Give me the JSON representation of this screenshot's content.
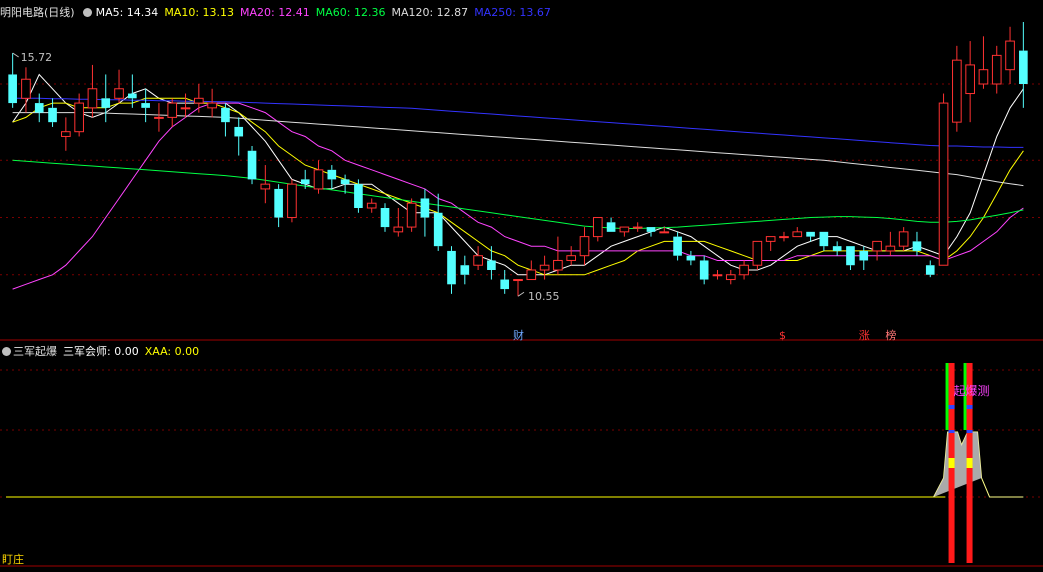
{
  "header": {
    "title": "明阳电路(日线)",
    "indicators": [
      {
        "label": "MA5: 14.34",
        "color": "#ffffff"
      },
      {
        "label": "MA10: 13.13",
        "color": "#ffff00"
      },
      {
        "label": "MA20: 12.41",
        "color": "#ff44ff"
      },
      {
        "label": "MA60: 12.36",
        "color": "#00ff44"
      },
      {
        "label": "MA120: 12.87",
        "color": "#dddddd"
      },
      {
        "label": "MA250: 13.67",
        "color": "#3333ff"
      }
    ]
  },
  "sub_header": {
    "title": "三军起爆",
    "indicators": [
      {
        "label": "三军会师: 0.00",
        "color": "#ffffff"
      },
      {
        "label": "XAA: 0.00",
        "color": "#ffff00"
      }
    ]
  },
  "footer": {
    "button_label": "盯庄"
  },
  "colors": {
    "up": "#ff3232",
    "down": "#54ffff",
    "grid": "#7a0000",
    "border": "#a00000",
    "hi_label": "#c0c0c0"
  },
  "chart_data": [
    {
      "type": "candlestick",
      "price_range": [
        9.8,
        16.3
      ],
      "high_label": "15.72",
      "low_label": "10.55",
      "candles": [
        [
          15.2,
          14.6,
          15.65,
          14.5
        ],
        [
          14.7,
          15.1,
          15.35,
          14.4
        ],
        [
          14.6,
          14.4,
          14.8,
          14.2
        ],
        [
          14.5,
          14.2,
          14.7,
          14.1
        ],
        [
          13.9,
          14.0,
          14.3,
          13.6
        ],
        [
          14.0,
          14.6,
          14.8,
          13.9
        ],
        [
          14.5,
          14.9,
          15.4,
          14.3
        ],
        [
          14.7,
          14.5,
          15.2,
          14.2
        ],
        [
          14.7,
          14.9,
          15.3,
          14.6
        ],
        [
          14.8,
          14.7,
          15.2,
          14.5
        ],
        [
          14.6,
          14.5,
          14.9,
          14.2
        ],
        [
          14.3,
          14.3,
          14.6,
          14.0
        ],
        [
          14.3,
          14.6,
          14.7,
          14.1
        ],
        [
          14.5,
          14.5,
          14.8,
          14.3
        ],
        [
          14.6,
          14.7,
          15.0,
          14.4
        ],
        [
          14.5,
          14.6,
          14.9,
          14.3
        ],
        [
          14.5,
          14.2,
          14.6,
          13.9
        ],
        [
          14.1,
          13.9,
          14.3,
          13.5
        ],
        [
          13.6,
          13.0,
          13.7,
          12.9
        ],
        [
          12.8,
          12.9,
          13.3,
          12.5
        ],
        [
          12.8,
          12.2,
          12.9,
          12.0
        ],
        [
          12.2,
          12.9,
          13.0,
          12.1
        ],
        [
          13.0,
          12.9,
          13.2,
          12.8
        ],
        [
          12.8,
          13.2,
          13.4,
          12.7
        ],
        [
          13.2,
          13.0,
          13.3,
          12.8
        ],
        [
          13.0,
          12.9,
          13.1,
          12.7
        ],
        [
          12.9,
          12.4,
          13.0,
          12.3
        ],
        [
          12.4,
          12.5,
          12.6,
          12.3
        ],
        [
          12.4,
          12.0,
          12.5,
          11.9
        ],
        [
          11.9,
          12.0,
          12.4,
          11.8
        ],
        [
          12.0,
          12.5,
          12.6,
          11.9
        ],
        [
          12.6,
          12.2,
          12.8,
          11.8
        ],
        [
          12.3,
          11.6,
          12.7,
          11.5
        ],
        [
          11.5,
          10.8,
          11.6,
          10.6
        ],
        [
          11.2,
          11.0,
          11.4,
          10.8
        ],
        [
          11.2,
          11.4,
          11.6,
          11.1
        ],
        [
          11.3,
          11.1,
          11.6,
          10.9
        ],
        [
          10.9,
          10.7,
          11.1,
          10.6
        ],
        [
          10.9,
          10.9,
          10.9,
          10.55
        ],
        [
          10.9,
          11.1,
          11.3,
          10.9
        ],
        [
          11.1,
          11.2,
          11.4,
          10.9
        ],
        [
          11.1,
          11.3,
          11.8,
          11.0
        ],
        [
          11.3,
          11.4,
          11.6,
          11.2
        ],
        [
          11.4,
          11.8,
          12.0,
          11.2
        ],
        [
          11.8,
          12.2,
          12.2,
          11.7
        ],
        [
          12.1,
          11.9,
          12.2,
          11.9
        ],
        [
          11.9,
          12.0,
          12.0,
          11.8
        ],
        [
          12.0,
          12.0,
          12.1,
          11.9
        ],
        [
          12.0,
          11.9,
          12.0,
          11.8
        ],
        [
          11.9,
          11.9,
          12.0,
          11.9
        ],
        [
          11.8,
          11.4,
          11.9,
          11.3
        ],
        [
          11.4,
          11.3,
          11.5,
          11.2
        ],
        [
          11.3,
          10.9,
          11.4,
          10.8
        ],
        [
          11.0,
          11.0,
          11.1,
          10.9
        ],
        [
          10.9,
          11.0,
          11.1,
          10.8
        ],
        [
          11.0,
          11.2,
          11.3,
          10.9
        ],
        [
          11.2,
          11.7,
          11.7,
          11.1
        ],
        [
          11.7,
          11.8,
          11.8,
          11.5
        ],
        [
          11.8,
          11.8,
          11.9,
          11.7
        ],
        [
          11.8,
          11.9,
          12.0,
          11.8
        ],
        [
          11.9,
          11.8,
          11.9,
          11.7
        ],
        [
          11.9,
          11.6,
          11.9,
          11.5
        ],
        [
          11.6,
          11.5,
          11.7,
          11.4
        ],
        [
          11.6,
          11.2,
          11.6,
          11.1
        ],
        [
          11.5,
          11.3,
          11.6,
          11.1
        ],
        [
          11.5,
          11.7,
          11.7,
          11.3
        ],
        [
          11.5,
          11.6,
          11.9,
          11.4
        ],
        [
          11.6,
          11.9,
          12.0,
          11.5
        ],
        [
          11.7,
          11.5,
          11.9,
          11.4
        ],
        [
          11.2,
          11.0,
          11.3,
          10.95
        ],
        [
          11.2,
          14.6,
          14.8,
          11.2
        ],
        [
          14.2,
          15.5,
          15.8,
          14.0
        ],
        [
          14.8,
          15.4,
          15.9,
          14.2
        ],
        [
          15.0,
          15.3,
          16.0,
          14.9
        ],
        [
          15.0,
          15.6,
          15.8,
          14.8
        ],
        [
          15.3,
          15.9,
          16.2,
          15.0
        ],
        [
          15.7,
          15.0,
          16.3,
          14.5
        ]
      ],
      "ma_series": [
        {
          "name": "MA5",
          "color": "#ffffff",
          "values": [
            14.2,
            14.6,
            15.2,
            14.9,
            14.6,
            14.4,
            14.3,
            14.4,
            14.6,
            14.8,
            14.9,
            14.7,
            14.6,
            14.6,
            14.6,
            14.6,
            14.6,
            14.4,
            14.1,
            13.8,
            13.4,
            13.0,
            12.9,
            12.8,
            12.8,
            12.9,
            12.9,
            12.9,
            12.7,
            12.5,
            12.3,
            12.3,
            12.3,
            12.0,
            11.7,
            11.4,
            11.3,
            11.2,
            11.0,
            11.0,
            11.0,
            11.1,
            11.2,
            11.2,
            11.4,
            11.6,
            11.7,
            11.8,
            11.9,
            12.0,
            11.9,
            11.8,
            11.6,
            11.4,
            11.2,
            11.1,
            11.1,
            11.2,
            11.4,
            11.6,
            11.7,
            11.8,
            11.8,
            11.7,
            11.6,
            11.5,
            11.5,
            11.5,
            11.6,
            11.5,
            11.4,
            11.8,
            12.3,
            13.1,
            13.9,
            14.5,
            14.9
          ]
        },
        {
          "name": "MA10",
          "color": "#ffff00",
          "values": [
            14.2,
            14.3,
            14.5,
            14.6,
            14.6,
            14.5,
            14.5,
            14.5,
            14.6,
            14.6,
            14.7,
            14.7,
            14.7,
            14.7,
            14.6,
            14.6,
            14.5,
            14.4,
            14.2,
            14.0,
            13.7,
            13.5,
            13.3,
            13.2,
            13.1,
            13.0,
            12.9,
            12.8,
            12.7,
            12.6,
            12.5,
            12.4,
            12.3,
            12.1,
            11.9,
            11.7,
            11.5,
            11.4,
            11.2,
            11.1,
            11.0,
            11.0,
            11.0,
            11.0,
            11.1,
            11.2,
            11.3,
            11.5,
            11.6,
            11.7,
            11.7,
            11.7,
            11.7,
            11.6,
            11.5,
            11.4,
            11.3,
            11.3,
            11.3,
            11.3,
            11.4,
            11.5,
            11.5,
            11.5,
            11.5,
            11.5,
            11.5,
            11.5,
            11.5,
            11.4,
            11.3,
            11.5,
            11.8,
            12.2,
            12.7,
            13.2,
            13.6
          ]
        },
        {
          "name": "MA20",
          "color": "#ff44ff",
          "values": [
            10.7,
            10.8,
            10.9,
            11.0,
            11.2,
            11.5,
            11.8,
            12.2,
            12.6,
            13.0,
            13.4,
            13.8,
            14.1,
            14.3,
            14.5,
            14.6,
            14.6,
            14.6,
            14.5,
            14.4,
            14.2,
            14.0,
            13.9,
            13.7,
            13.6,
            13.4,
            13.3,
            13.2,
            13.1,
            13.0,
            12.9,
            12.8,
            12.6,
            12.5,
            12.3,
            12.1,
            12.0,
            11.8,
            11.7,
            11.6,
            11.6,
            11.5,
            11.5,
            11.5,
            11.5,
            11.5,
            11.5,
            11.5,
            11.5,
            11.5,
            11.5,
            11.4,
            11.4,
            11.3,
            11.3,
            11.3,
            11.3,
            11.3,
            11.3,
            11.4,
            11.4,
            11.4,
            11.4,
            11.4,
            11.4,
            11.4,
            11.4,
            11.4,
            11.4,
            11.4,
            11.3,
            11.4,
            11.5,
            11.7,
            11.9,
            12.2,
            12.4
          ]
        },
        {
          "name": "MA60",
          "color": "#00ff44",
          "values": [
            13.4,
            13.38,
            13.36,
            13.34,
            13.32,
            13.3,
            13.28,
            13.26,
            13.24,
            13.22,
            13.2,
            13.18,
            13.16,
            13.14,
            13.12,
            13.1,
            13.08,
            13.05,
            13.02,
            12.98,
            12.94,
            12.9,
            12.86,
            12.82,
            12.78,
            12.74,
            12.7,
            12.66,
            12.62,
            12.58,
            12.54,
            12.5,
            12.46,
            12.42,
            12.38,
            12.34,
            12.3,
            12.26,
            12.22,
            12.18,
            12.14,
            12.1,
            12.06,
            12.02,
            12.0,
            11.98,
            11.97,
            11.97,
            11.98,
            11.99,
            12.0,
            12.02,
            12.04,
            12.06,
            12.08,
            12.1,
            12.12,
            12.14,
            12.16,
            12.18,
            12.2,
            12.21,
            12.22,
            12.22,
            12.21,
            12.2,
            12.18,
            12.15,
            12.12,
            12.1,
            12.1,
            12.12,
            12.15,
            12.2,
            12.25,
            12.3,
            12.36
          ]
        },
        {
          "name": "MA120",
          "color": "#dddddd",
          "values": [
            14.4,
            14.4,
            14.4,
            14.4,
            14.4,
            14.4,
            14.4,
            14.39,
            14.38,
            14.37,
            14.36,
            14.35,
            14.34,
            14.33,
            14.32,
            14.31,
            14.3,
            14.28,
            14.26,
            14.24,
            14.22,
            14.2,
            14.18,
            14.16,
            14.14,
            14.12,
            14.1,
            14.08,
            14.06,
            14.04,
            14.02,
            14.0,
            13.98,
            13.96,
            13.94,
            13.92,
            13.9,
            13.88,
            13.86,
            13.84,
            13.82,
            13.8,
            13.78,
            13.76,
            13.74,
            13.72,
            13.7,
            13.68,
            13.66,
            13.64,
            13.62,
            13.6,
            13.58,
            13.56,
            13.54,
            13.52,
            13.5,
            13.48,
            13.46,
            13.44,
            13.42,
            13.4,
            13.37,
            13.34,
            13.31,
            13.28,
            13.25,
            13.22,
            13.19,
            13.16,
            13.13,
            13.1,
            13.05,
            13.0,
            12.95,
            12.91,
            12.87
          ]
        },
        {
          "name": "MA250",
          "color": "#3333ff",
          "values": [
            14.7,
            14.7,
            14.7,
            14.69,
            14.69,
            14.68,
            14.68,
            14.67,
            14.67,
            14.66,
            14.66,
            14.65,
            14.65,
            14.64,
            14.64,
            14.63,
            14.63,
            14.62,
            14.61,
            14.6,
            14.59,
            14.58,
            14.57,
            14.56,
            14.55,
            14.54,
            14.53,
            14.52,
            14.51,
            14.5,
            14.49,
            14.47,
            14.45,
            14.43,
            14.41,
            14.39,
            14.37,
            14.35,
            14.33,
            14.31,
            14.29,
            14.27,
            14.25,
            14.23,
            14.21,
            14.19,
            14.17,
            14.15,
            14.13,
            14.11,
            14.09,
            14.07,
            14.05,
            14.03,
            14.01,
            13.99,
            13.97,
            13.95,
            13.93,
            13.91,
            13.89,
            13.87,
            13.85,
            13.83,
            13.81,
            13.79,
            13.77,
            13.75,
            13.73,
            13.71,
            13.7,
            13.7,
            13.69,
            13.68,
            13.68,
            13.67,
            13.67
          ]
        }
      ],
      "event_labels": [
        {
          "text": "财",
          "index": 38,
          "color": "#6fa8ff"
        },
        {
          "text": "$",
          "index": 58,
          "color": "#ff3333"
        },
        {
          "text": "涨",
          "index": 64,
          "color": "#ff3333"
        },
        {
          "text": "榜",
          "index": 66,
          "color": "#ff7777"
        }
      ]
    },
    {
      "type": "bar",
      "annotation": {
        "text": "起爆测",
        "color": "#ff44ff"
      }
    }
  ]
}
